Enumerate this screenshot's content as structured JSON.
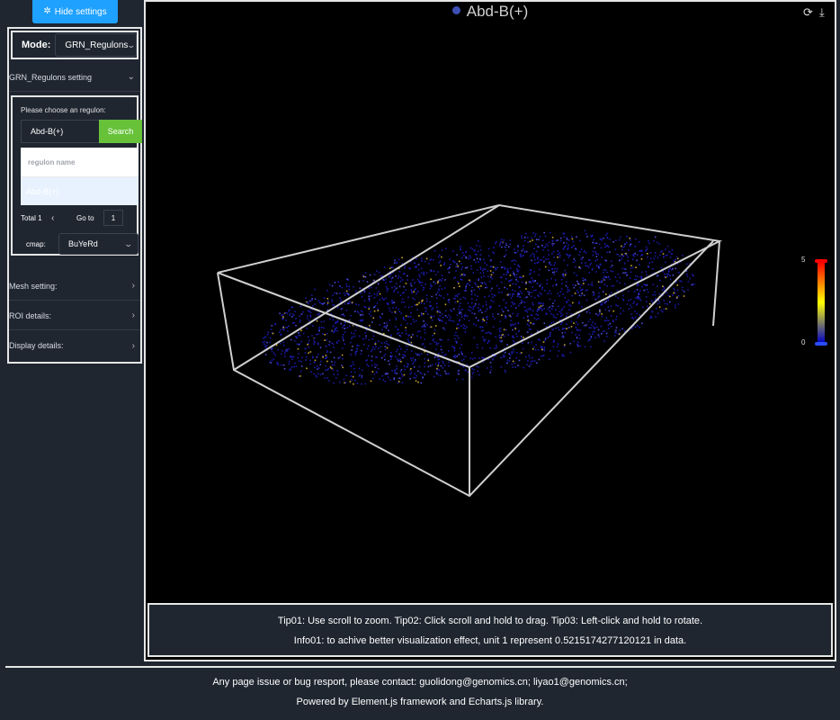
{
  "sidebar": {
    "hide_settings_label": "Hide settings",
    "mode_label": "Mode:",
    "mode_value": "GRN_Regulons",
    "grn_section_label": "GRN_Regulons setting",
    "choose_label": "Please choose an regulon:",
    "regulon_input_value": "Abd-B(+)",
    "search_label": "Search",
    "list_header": "regulon name",
    "list_item": "Abd-B(+)",
    "pager_total": "Total 1",
    "pager_goto": "Go to",
    "pager_page": "1",
    "cmap_label": "cmap:",
    "cmap_value": "BuYeRd",
    "mesh_label": "Mesh setting:",
    "roi_label": "ROI details:",
    "display_label": "Display details:"
  },
  "chart": {
    "title": "Abd-B(+)",
    "series_color": "#3d4fb5",
    "colorbar_max": "5",
    "colorbar_min": "0",
    "colormap_colors": [
      "#0000c8",
      "#ffff00",
      "#ff0000"
    ],
    "refresh_icon": "refresh-icon",
    "download_icon": "download-icon"
  },
  "tips": {
    "tip_line": "Tip01: Use scroll to zoom. Tip02: Click scroll and hold to drag. Tip03: Left-click and hold to rotate.",
    "info_line": "Info01: to achive better visualization effect, unit 1 represent 0.5215174277120121 in data."
  },
  "footer": {
    "contact": "Any page issue or bug resport, please contact: guolidong@genomics.cn; liyao1@genomics.cn;",
    "powered": "Powered by Element.js framework and Echarts.js library."
  }
}
